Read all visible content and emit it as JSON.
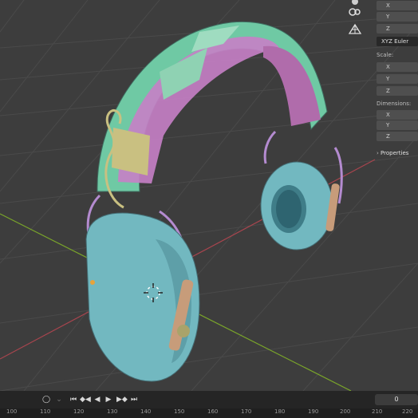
{
  "npanel": {
    "rotation_axes": [
      "X",
      "Y",
      "Z"
    ],
    "rotation_mode": "XYZ Euler",
    "scale_label": "Scale:",
    "scale_axes": [
      "X",
      "Y",
      "Z"
    ],
    "dimensions_label": "Dimensions:",
    "dimension_axes": [
      "X",
      "Y",
      "Z"
    ],
    "properties_label": "Properties"
  },
  "gizmo": {
    "icons": [
      "camera-view-icon",
      "grid-view-icon"
    ]
  },
  "timeline": {
    "controls": [
      "jump-start",
      "prev-keyframe",
      "play-reverse",
      "play",
      "next-keyframe",
      "jump-end"
    ],
    "current_frame": "0",
    "ruler_ticks": [
      "100",
      "110",
      "120",
      "130",
      "140",
      "150",
      "160",
      "170",
      "180",
      "190",
      "200",
      "210",
      "220"
    ]
  },
  "colors": {
    "viewport_bg": "#3d3d3d",
    "grid_line": "#4a4a4a",
    "axis_x": "#a8454e",
    "axis_y": "#7aa52a",
    "earcup": "#72b8c0",
    "headband_green": "#6fc9a4",
    "headband_pink": "#c77fc6",
    "headband_yellow": "#c9c081",
    "slider_wood": "#c79c7a"
  }
}
